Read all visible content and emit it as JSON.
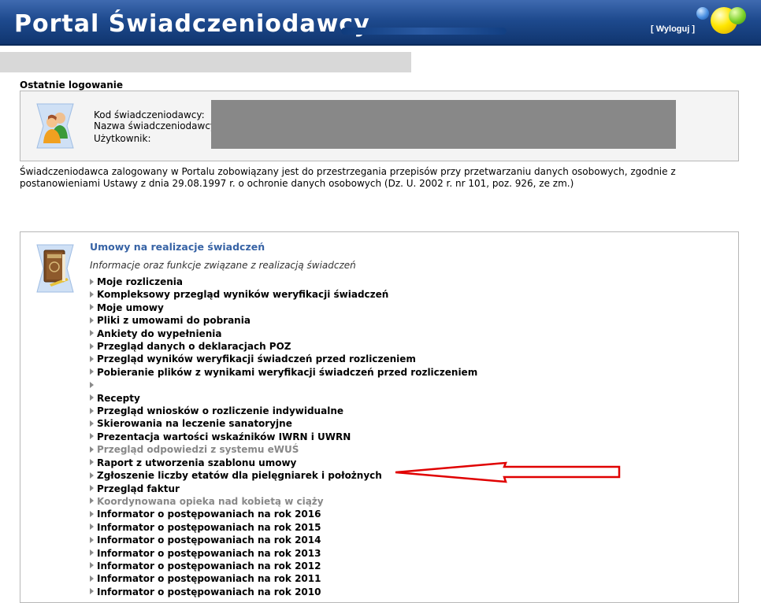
{
  "header": {
    "title": "Portal Świadczeniodawcy",
    "logout_label": "[ Wyloguj ]"
  },
  "last_login": {
    "heading": "Ostatnie logowanie",
    "labels": [
      "Kod świadczeniodawcy:",
      "Nazwa świadczeniodawcy:",
      "Użytkownik:"
    ]
  },
  "privacy_notice": "Świadczeniodawca zalogowany w Portalu zobowiązany jest do przestrzegania przepisów przy przetwarzaniu danych osobowych, zgodnie z postanowieniami Ustawy z dnia 29.08.1997 r. o ochronie danych osobowych (Dz. U. 2002 r. nr 101, poz. 926, ze zm.)",
  "section": {
    "title": "Umowy na realizacje świadczeń",
    "subtitle": "Informacje oraz funkcje związane z realizacją świadczeń",
    "items": [
      {
        "label": "Moje rozliczenia",
        "enabled": true
      },
      {
        "label": "Kompleksowy przegląd wyników weryfikacji świadczeń",
        "enabled": true
      },
      {
        "label": "Moje umowy",
        "enabled": true
      },
      {
        "label": "Pliki z umowami do pobrania",
        "enabled": true
      },
      {
        "label": "Ankiety do wypełnienia",
        "enabled": true
      },
      {
        "label": "Przegląd danych o deklaracjach POZ",
        "enabled": true
      },
      {
        "label": "Przegląd wyników weryfikacji świadczeń przed rozliczeniem",
        "enabled": true
      },
      {
        "label": "Pobieranie plików z wynikami weryfikacji świadczeń przed rozliczeniem",
        "enabled": true
      },
      {
        "label": "",
        "enabled": true
      },
      {
        "label": "Recepty",
        "enabled": true
      },
      {
        "label": "Przegląd wniosków o rozliczenie indywidualne",
        "enabled": true
      },
      {
        "label": "Skierowania na leczenie sanatoryjne",
        "enabled": true
      },
      {
        "label": "Prezentacja wartości wskaźników IWRN i UWRN",
        "enabled": true
      },
      {
        "label": "Przegląd odpowiedzi z systemu eWUŚ",
        "enabled": false
      },
      {
        "label": "Raport z utworzenia szablonu umowy",
        "enabled": true
      },
      {
        "label": "Zgłoszenie liczby etatów dla pielęgniarek i położnych",
        "enabled": true
      },
      {
        "label": "Przegląd faktur",
        "enabled": true
      },
      {
        "label": "Koordynowana opieka nad kobietą w ciąży",
        "enabled": false
      },
      {
        "label": "Informator o postępowaniach na rok 2016",
        "enabled": true
      },
      {
        "label": "Informator o postępowaniach na rok 2015",
        "enabled": true
      },
      {
        "label": "Informator o postępowaniach na rok 2014",
        "enabled": true
      },
      {
        "label": "Informator o postępowaniach na rok 2013",
        "enabled": true
      },
      {
        "label": "Informator o postępowaniach na rok 2012",
        "enabled": true
      },
      {
        "label": "Informator o postępowaniach na rok 2011",
        "enabled": true
      },
      {
        "label": "Informator o postępowaniach na rok 2010",
        "enabled": true
      }
    ]
  },
  "colors": {
    "header_blue": "#1e4a8e",
    "section_title": "#3763a5",
    "disabled_text": "#888888",
    "annotation_red": "#e00000"
  }
}
